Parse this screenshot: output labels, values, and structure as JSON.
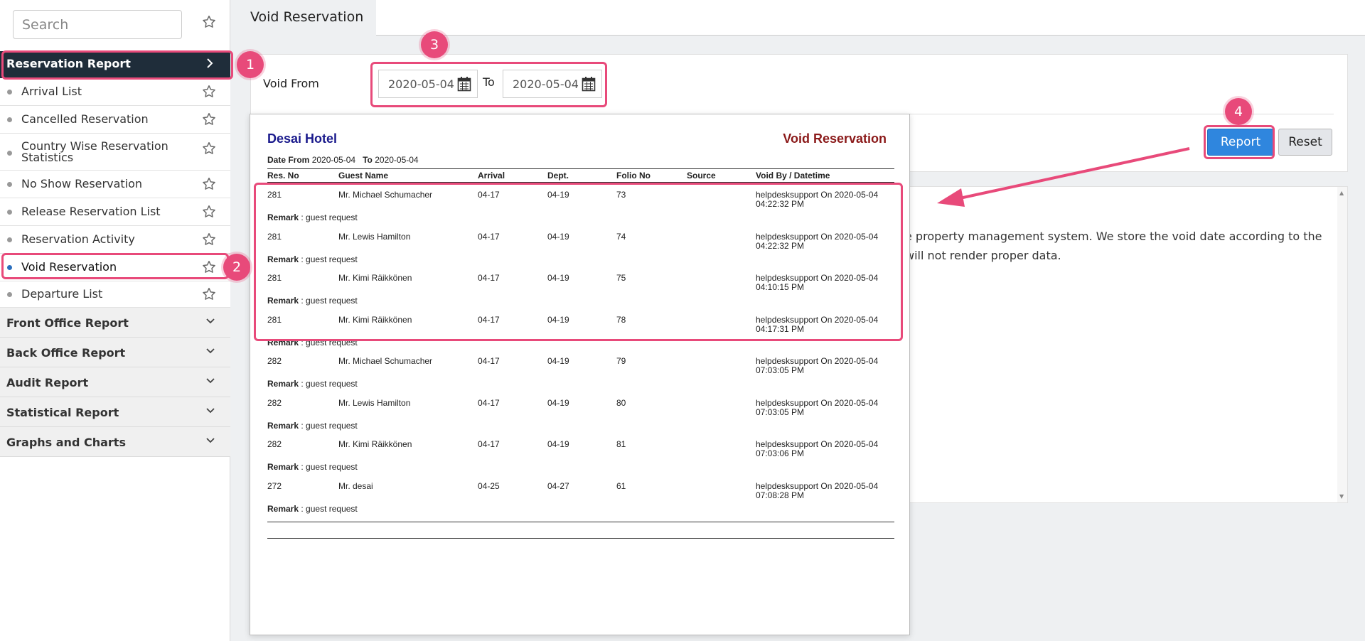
{
  "sidebar": {
    "search_placeholder": "Search",
    "active_section": "Reservation Report",
    "items": [
      {
        "label": "Arrival List"
      },
      {
        "label": "Cancelled Reservation"
      },
      {
        "label": "Country Wise Reservation",
        "label2": "Statistics"
      },
      {
        "label": "No Show Reservation"
      },
      {
        "label": "Release Reservation List"
      },
      {
        "label": "Reservation Activity"
      },
      {
        "label": "Void Reservation",
        "active": true
      },
      {
        "label": "Departure List"
      }
    ],
    "sections": [
      {
        "label": "Front Office Report"
      },
      {
        "label": "Back Office Report"
      },
      {
        "label": "Audit Report"
      },
      {
        "label": "Statistical Report"
      },
      {
        "label": "Graphs and Charts"
      }
    ]
  },
  "tab": {
    "title": "Void Reservation"
  },
  "filter": {
    "void_from_label": "Void From",
    "from_date": "2020-05-04",
    "to_label": "To",
    "to_date": "2020-05-04"
  },
  "buttons": {
    "report": "Report",
    "reset": "Reset"
  },
  "info": {
    "line1": "e property management system. We store the void date according to the",
    "line2": "will not render proper data."
  },
  "report": {
    "hotel": "Desai Hotel",
    "title": "Void Reservation",
    "date_from_label": "Date From",
    "date_from": "2020-05-04",
    "to_label": "To",
    "date_to": "2020-05-04",
    "columns": [
      "Res. No",
      "Guest Name",
      "Arrival",
      "Dept.",
      "Folio No",
      "Source",
      "Void By / Datetime"
    ],
    "remark_label": "Remark",
    "rows": [
      {
        "res": "281",
        "guest": "Mr. Michael Schumacher",
        "arr": "04-17",
        "dep": "04-19",
        "folio": "73",
        "source": "",
        "voidby": "helpdesksupport On 2020-05-04",
        "time": "04:22:32 PM",
        "remark": "guest request"
      },
      {
        "res": "281",
        "guest": "Mr. Lewis Hamilton",
        "arr": "04-17",
        "dep": "04-19",
        "folio": "74",
        "source": "",
        "voidby": "helpdesksupport On 2020-05-04",
        "time": "04:22:32 PM",
        "remark": "guest request"
      },
      {
        "res": "281",
        "guest": "Mr. Kimi Räikkönen",
        "arr": "04-17",
        "dep": "04-19",
        "folio": "75",
        "source": "",
        "voidby": "helpdesksupport On 2020-05-04",
        "time": "04:10:15 PM",
        "remark": "guest request"
      },
      {
        "res": "281",
        "guest": "Mr. Kimi Räikkönen",
        "arr": "04-17",
        "dep": "04-19",
        "folio": "78",
        "source": "",
        "voidby": "helpdesksupport On 2020-05-04",
        "time": "04:17:31 PM",
        "remark": "guest request"
      },
      {
        "res": "282",
        "guest": "Mr. Michael Schumacher",
        "arr": "04-17",
        "dep": "04-19",
        "folio": "79",
        "source": "",
        "voidby": "helpdesksupport On 2020-05-04",
        "time": "07:03:05 PM",
        "remark": "guest request"
      },
      {
        "res": "282",
        "guest": "Mr. Lewis Hamilton",
        "arr": "04-17",
        "dep": "04-19",
        "folio": "80",
        "source": "",
        "voidby": "helpdesksupport On 2020-05-04",
        "time": "07:03:05 PM",
        "remark": "guest request"
      },
      {
        "res": "282",
        "guest": "Mr. Kimi Räikkönen",
        "arr": "04-17",
        "dep": "04-19",
        "folio": "81",
        "source": "",
        "voidby": "helpdesksupport On 2020-05-04",
        "time": "07:03:06 PM",
        "remark": "guest request"
      },
      {
        "res": "272",
        "guest": "Mr. desai",
        "arr": "04-25",
        "dep": "04-27",
        "folio": "61",
        "source": "",
        "voidby": "helpdesksupport On 2020-05-04",
        "time": "07:08:28 PM",
        "remark": "guest request"
      }
    ]
  },
  "annotations": {
    "badges": [
      "1",
      "2",
      "3",
      "4"
    ],
    "color": "#e84a7a"
  },
  "colors": {
    "sidebar_active_bg": "#1f2d3a",
    "report_button": "#2f86de",
    "hotel_name": "#1a1a8c",
    "report_title": "#8b1a1a"
  },
  "icons": [
    "star-icon",
    "chevron-right-icon",
    "chevron-down-icon",
    "calendar-icon"
  ]
}
